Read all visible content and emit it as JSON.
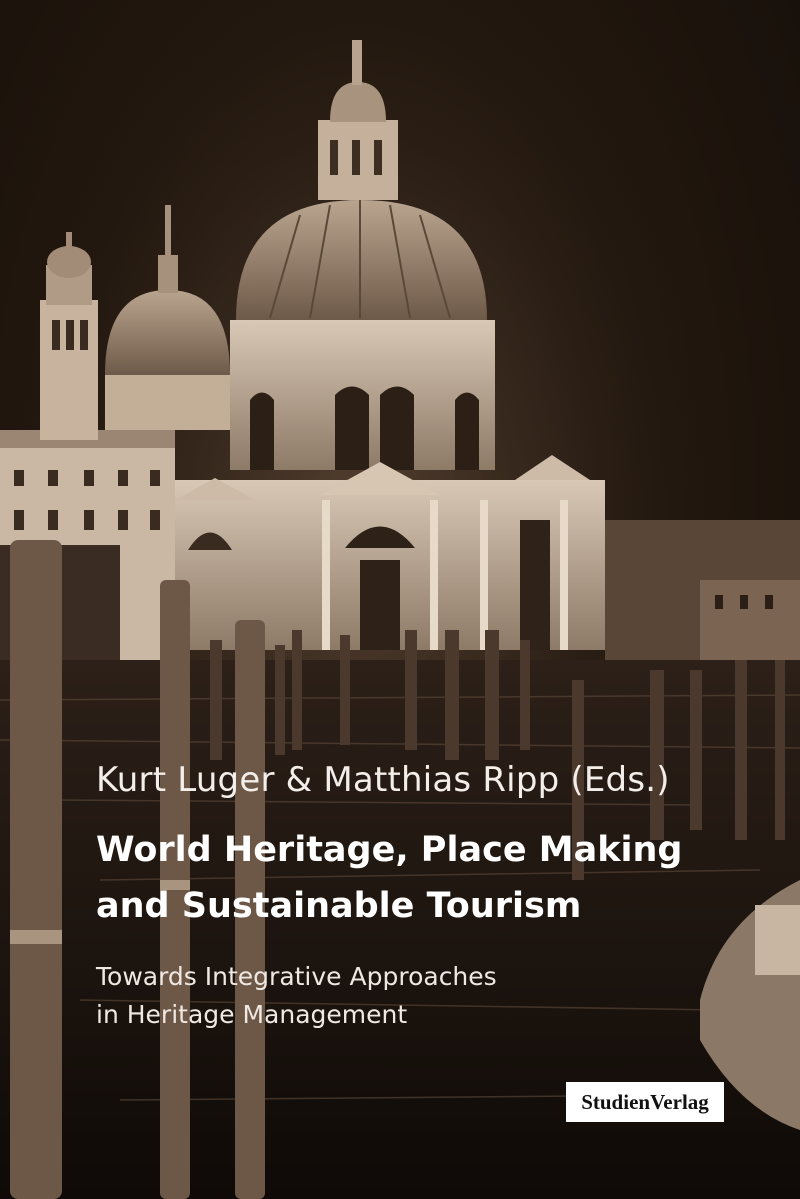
{
  "authors": "Kurt Luger & Matthias Ripp (Eds.)",
  "title": {
    "line1": "World Heritage, Place Making",
    "line2": "and Sustainable Tourism"
  },
  "subtitle": {
    "line1": "Towards Integrative Approaches",
    "line2": "in Heritage Management"
  },
  "publisher": "StudienVerlag",
  "colors": {
    "background": "#1a130e",
    "sepia_light": "#e9dccd",
    "sepia_mid": "#a08a74",
    "text": "#ffffff"
  }
}
